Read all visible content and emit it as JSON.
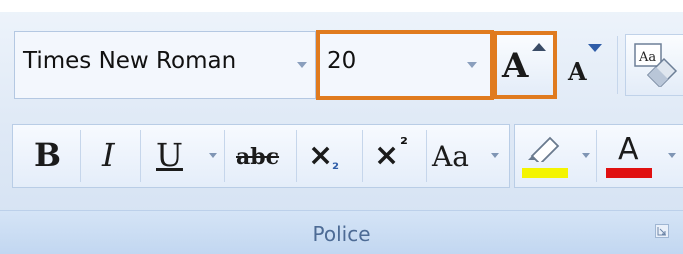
{
  "font_name": {
    "value": "Times New Roman"
  },
  "font_size": {
    "value": "20"
  },
  "icons": {
    "grow_font": "grow-font-icon",
    "shrink_font": "shrink-font-icon",
    "clear_formatting": "clear-formatting-icon",
    "strikethrough": "strikethrough-icon",
    "subscript": "subscript-icon",
    "superscript": "superscript-icon",
    "change_case": "change-case-icon",
    "highlight": "highlighter-icon",
    "font_color": "font-color-icon",
    "dialog_launcher": "dialog-launcher-icon"
  },
  "buttons": {
    "grow_font_letter": "A",
    "shrink_font_letter": "A",
    "clear_formatting_text": "Aa",
    "bold": "B",
    "italic": "I",
    "underline": "U",
    "strikethrough": "abc",
    "subscript_main": "×",
    "subscript_small": "₂",
    "superscript_main": "×",
    "superscript_small": "²",
    "change_case": "Aa",
    "font_color_letter": "A"
  },
  "colors": {
    "highlight_color": "#f4f400",
    "font_color": "#e01010",
    "focus_outline": "#e07b1f"
  },
  "group": {
    "label": "Police"
  }
}
